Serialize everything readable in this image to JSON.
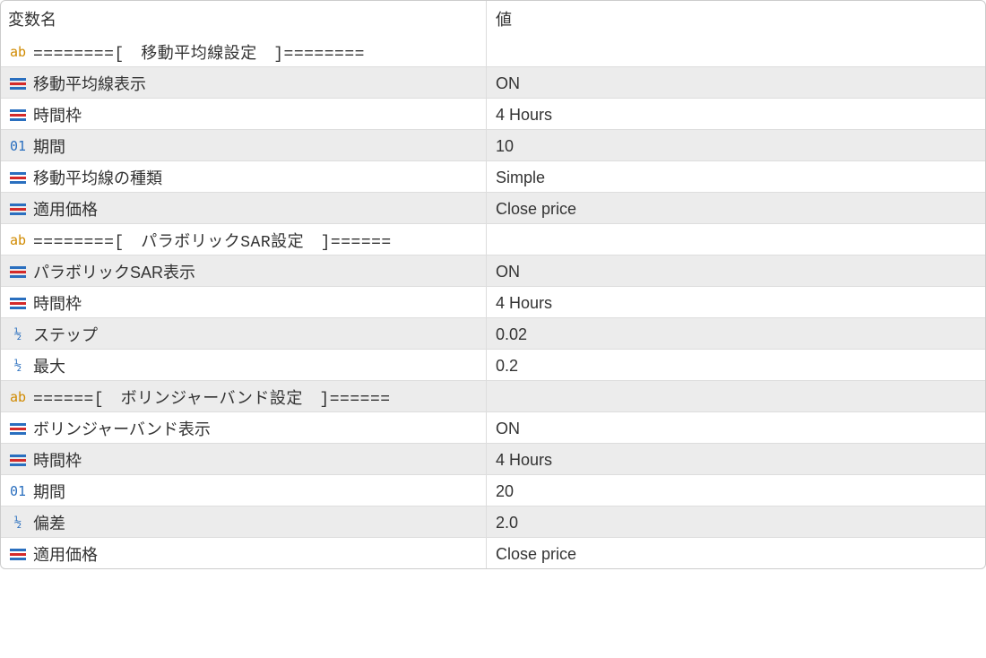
{
  "header": {
    "name": "変数名",
    "value": "値"
  },
  "rows": [
    {
      "icon": "ab",
      "name": "========[　移動平均線設定　]========",
      "value": "",
      "zebra": false
    },
    {
      "icon": "enum",
      "name": "移動平均線表示",
      "value": "ON",
      "zebra": true
    },
    {
      "icon": "enum",
      "name": "時間枠",
      "value": "4 Hours",
      "zebra": false
    },
    {
      "icon": "int",
      "name": "期間",
      "value": "10",
      "zebra": true
    },
    {
      "icon": "enum",
      "name": "移動平均線の種類",
      "value": "Simple",
      "zebra": false
    },
    {
      "icon": "enum",
      "name": "適用価格",
      "value": "Close price",
      "zebra": true
    },
    {
      "icon": "ab",
      "name": "========[　パラボリックSAR設定　]======",
      "value": "",
      "zebra": false
    },
    {
      "icon": "enum",
      "name": "パラボリックSAR表示",
      "value": "ON",
      "zebra": true
    },
    {
      "icon": "enum",
      "name": "時間枠",
      "value": "4 Hours",
      "zebra": false
    },
    {
      "icon": "frac",
      "name": "ステップ",
      "value": "0.02",
      "zebra": true
    },
    {
      "icon": "frac",
      "name": "最大",
      "value": "0.2",
      "zebra": false
    },
    {
      "icon": "ab",
      "name": "======[　ボリンジャーバンド設定　]======",
      "value": "",
      "zebra": true
    },
    {
      "icon": "enum",
      "name": "ボリンジャーバンド表示",
      "value": "ON",
      "zebra": false
    },
    {
      "icon": "enum",
      "name": "時間枠",
      "value": "4 Hours",
      "zebra": true
    },
    {
      "icon": "int",
      "name": "期間",
      "value": "20",
      "zebra": false
    },
    {
      "icon": "frac",
      "name": "偏差",
      "value": "2.0",
      "zebra": true
    },
    {
      "icon": "enum",
      "name": "適用価格",
      "value": "Close price",
      "zebra": false
    }
  ]
}
